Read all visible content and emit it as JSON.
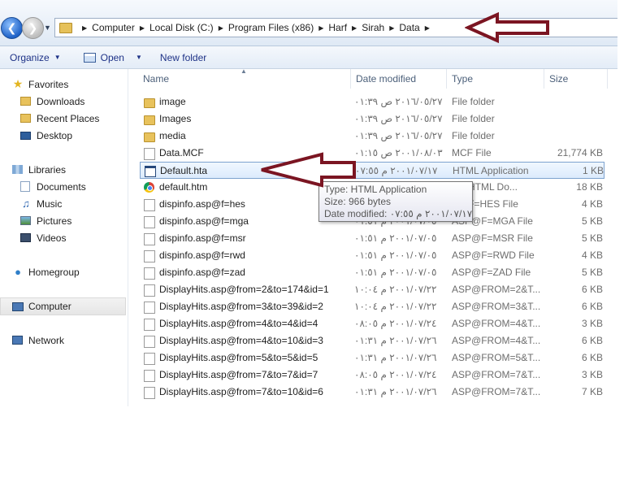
{
  "breadcrumb": [
    "Computer",
    "Local Disk (C:)",
    "Program Files (x86)",
    "Harf",
    "Sirah",
    "Data"
  ],
  "toolbar": {
    "organize": "Organize",
    "open": "Open",
    "new_folder": "New folder"
  },
  "sidebar": {
    "favorites": "Favorites",
    "favorites_items": [
      "Downloads",
      "Recent Places",
      "Desktop"
    ],
    "libraries": "Libraries",
    "libraries_items": [
      "Documents",
      "Music",
      "Pictures",
      "Videos"
    ],
    "homegroup": "Homegroup",
    "computer": "Computer",
    "network": "Network"
  },
  "columns": {
    "name": "Name",
    "date": "Date modified",
    "type": "Type",
    "size": "Size"
  },
  "files": [
    {
      "name": "image",
      "date": "٢٠١٦/٠٥/٢٧ ص ٠١:٣٩",
      "type": "File folder",
      "size": "",
      "icon": "folder-icon"
    },
    {
      "name": "Images",
      "date": "٢٠١٦/٠٥/٢٧ ص ٠١:٣٩",
      "type": "File folder",
      "size": "",
      "icon": "folder-icon"
    },
    {
      "name": "media",
      "date": "٢٠١٦/٠٥/٢٧ ص ٠١:٣٩",
      "type": "File folder",
      "size": "",
      "icon": "folder-icon"
    },
    {
      "name": "Data.MCF",
      "date": "٢٠٠١/٠٨/٠٣ ص ٠١:١٥",
      "type": "MCF File",
      "size": "21,774 KB",
      "icon": "file-icon"
    },
    {
      "name": "Default.hta",
      "date": "٢٠٠١/٠٧/١٧ م ٠٧:٥٥",
      "type": "HTML Application",
      "size": "1 KB",
      "icon": "hta-icon"
    },
    {
      "name": "default.htm",
      "date": "",
      "type": "me HTML Do...",
      "size": "18 KB",
      "icon": "chrome-icon"
    },
    {
      "name": "dispinfo.asp@f=hes",
      "date": "",
      "type": "P@F=HES File",
      "size": "4 KB",
      "icon": "file-icon"
    },
    {
      "name": "dispinfo.asp@f=mga",
      "date": "٢٠٠١/٠٧/٠٥ م ٠١:٥١",
      "type": "ASP@F=MGA File",
      "size": "5 KB",
      "icon": "file-icon"
    },
    {
      "name": "dispinfo.asp@f=msr",
      "date": "٢٠٠١/٠٧/٠٥ م ٠١:٥١",
      "type": "ASP@F=MSR File",
      "size": "5 KB",
      "icon": "file-icon"
    },
    {
      "name": "dispinfo.asp@f=rwd",
      "date": "٢٠٠١/٠٧/٠٥ م ٠١:٥١",
      "type": "ASP@F=RWD File",
      "size": "4 KB",
      "icon": "file-icon"
    },
    {
      "name": "dispinfo.asp@f=zad",
      "date": "٢٠٠١/٠٧/٠٥ م ٠١:٥١",
      "type": "ASP@F=ZAD File",
      "size": "5 KB",
      "icon": "file-icon"
    },
    {
      "name": "DisplayHits.asp@from=2&to=174&id=1",
      "date": "٢٠٠١/٠٧/٢٢ م ١٠:٠٤",
      "type": "ASP@FROM=2&T...",
      "size": "6 KB",
      "icon": "file-icon"
    },
    {
      "name": "DisplayHits.asp@from=3&to=39&id=2",
      "date": "٢٠٠١/٠٧/٢٢ م ١٠:٠٤",
      "type": "ASP@FROM=3&T...",
      "size": "6 KB",
      "icon": "file-icon"
    },
    {
      "name": "DisplayHits.asp@from=4&to=4&id=4",
      "date": "٢٠٠١/٠٧/٢٤ م ٠٨:٠٥",
      "type": "ASP@FROM=4&T...",
      "size": "3 KB",
      "icon": "file-icon"
    },
    {
      "name": "DisplayHits.asp@from=4&to=10&id=3",
      "date": "٢٠٠١/٠٧/٢٦ م ٠١:٣١",
      "type": "ASP@FROM=4&T...",
      "size": "6 KB",
      "icon": "file-icon"
    },
    {
      "name": "DisplayHits.asp@from=5&to=5&id=5",
      "date": "٢٠٠١/٠٧/٢٦ م ٠١:٣١",
      "type": "ASP@FROM=5&T...",
      "size": "6 KB",
      "icon": "file-icon"
    },
    {
      "name": "DisplayHits.asp@from=7&to=7&id=7",
      "date": "٢٠٠١/٠٧/٢٤ م ٠٨:٠٥",
      "type": "ASP@FROM=7&T...",
      "size": "3 KB",
      "icon": "file-icon"
    },
    {
      "name": "DisplayHits.asp@from=7&to=10&id=6",
      "date": "٢٠٠١/٠٧/٢٦ م ٠١:٣١",
      "type": "ASP@FROM=7&T...",
      "size": "7 KB",
      "icon": "file-icon"
    }
  ],
  "tooltip": {
    "type": "Type: HTML Application",
    "size": "Size: 966 bytes",
    "date": "Date modified: ٢٠٠١/٠٧/١٧ م ٠٧:٥٥"
  },
  "colors": {
    "annotation_arrow": "#7b1522",
    "toolbar_text": "#1e3287",
    "selection_border": "#7da2ce"
  }
}
